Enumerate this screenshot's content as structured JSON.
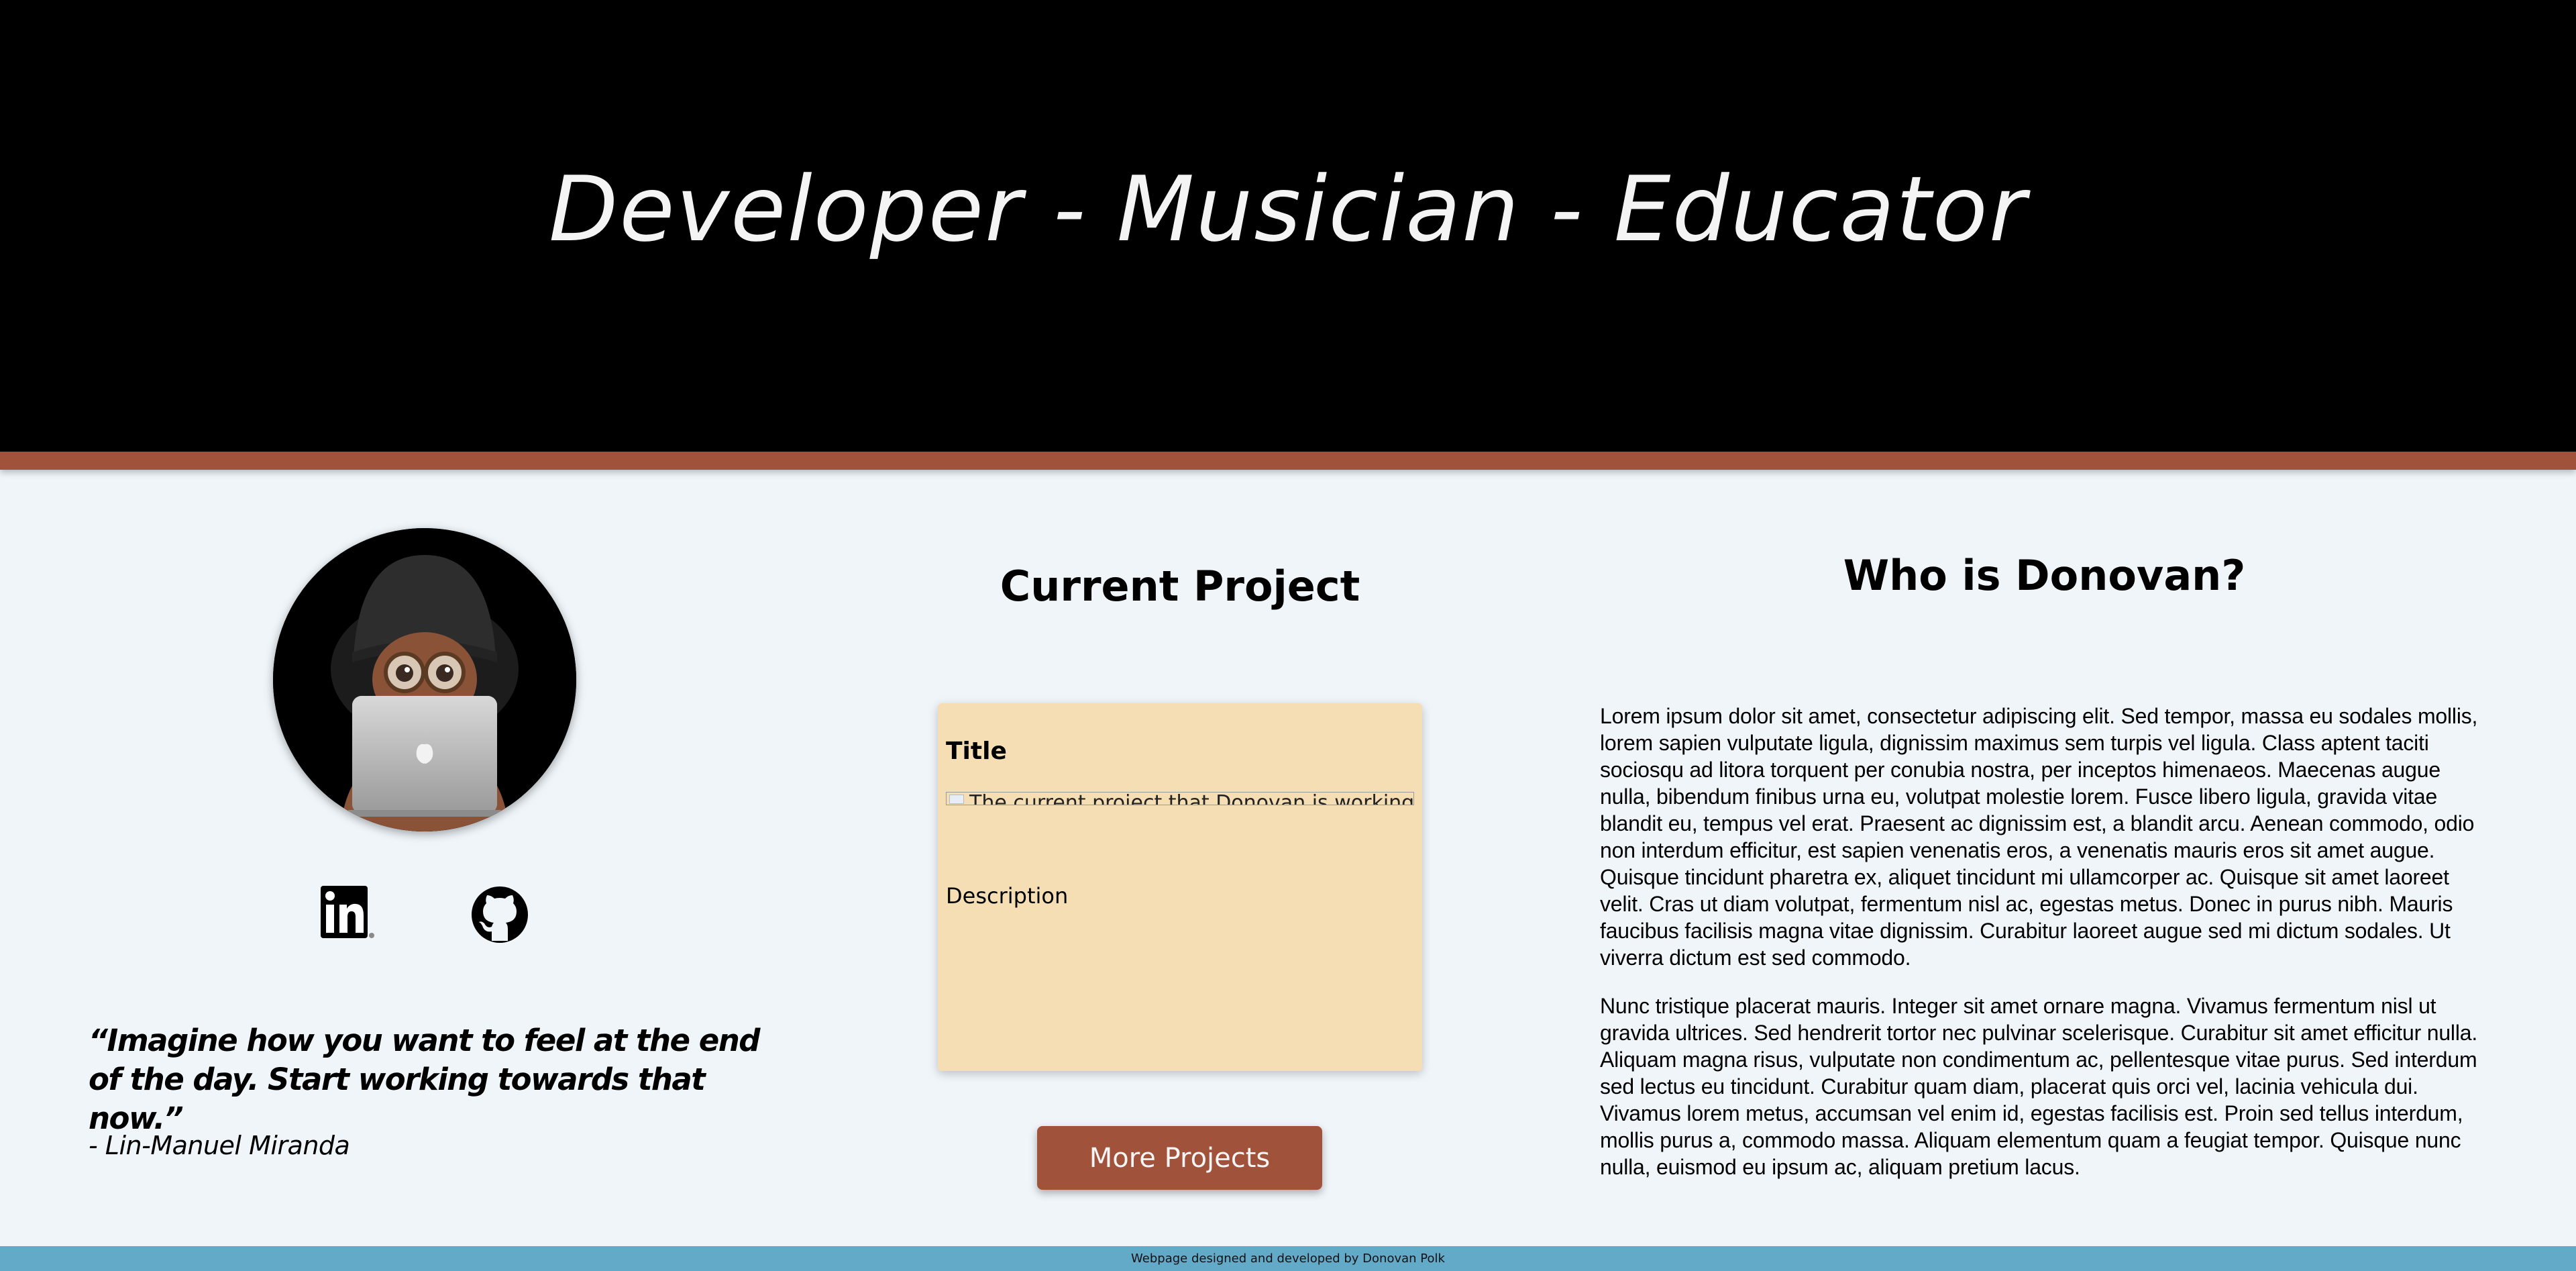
{
  "hero": {
    "title": "Developer - Musician - Educator"
  },
  "profile": {
    "avatar_icon": "memoji-avatar-with-laptop",
    "social": [
      {
        "name": "LinkedIn",
        "icon": "linkedin-icon"
      },
      {
        "name": "GitHub",
        "icon": "github-icon"
      }
    ]
  },
  "quote": {
    "text": "“Imagine how you want to feel at the end of the day. Start working towards that now.”",
    "author": "- Lin-Manuel Miranda"
  },
  "current_project": {
    "heading": "Current Project",
    "card_title": "Title",
    "image_alt": "The current project that Donovan is working on",
    "description": "Description",
    "button_label": "More Projects"
  },
  "about": {
    "heading": "Who is Donovan?",
    "paragraphs": [
      "Lorem ipsum dolor sit amet, consectetur adipiscing elit. Sed tempor, massa eu sodales mollis, lorem sapien vulputate ligula, dignissim maximus sem turpis vel ligula. Class aptent taciti sociosqu ad litora torquent per conubia nostra, per inceptos himenaeos. Maecenas augue nulla, bibendum finibus urna eu, volutpat molestie lorem. Fusce libero ligula, gravida vitae blandit eu, tempus vel erat. Praesent ac dignissim est, a blandit arcu. Aenean commodo, odio non interdum efficitur, est sapien venenatis eros, a venenatis mauris eros sit amet augue. Quisque tincidunt pharetra ex, aliquet tincidunt mi ullamcorper ac. Quisque sit amet laoreet velit. Cras ut diam volutpat, fermentum nisl ac, egestas metus. Donec in purus nibh. Mauris faucibus facilisis magna vitae dignissim. Curabitur laoreet augue sed mi dictum sodales. Ut viverra dictum est sed commodo.",
      "Nunc tristique placerat mauris. Integer sit amet ornare magna. Vivamus fermentum nisl ut gravida ultrices. Sed hendrerit tortor nec pulvinar scelerisque. Curabitur sit amet efficitur nulla. Aliquam magna risus, vulputate non condimentum ac, pellentesque vitae purus. Sed interdum sed lectus eu tincidunt. Curabitur quam diam, placerat quis orci vel, lacinia vehicula dui. Vivamus lorem metus, accumsan vel enim id, egestas facilisis est. Proin sed tellus interdum, mollis purus a, commodo massa. Aliquam elementum quam a feugiat tempor. Quisque nunc nulla, euismod eu ipsum ac, aliquam pretium lacus."
    ]
  },
  "footer": {
    "text": "Webpage designed and developed by Donovan Polk"
  },
  "colors": {
    "hero_bg": "#000000",
    "accent": "#a0533a",
    "page_bg": "#eff5f9",
    "card_bg": "#f5deb3",
    "footer_bg": "#63aac9"
  }
}
